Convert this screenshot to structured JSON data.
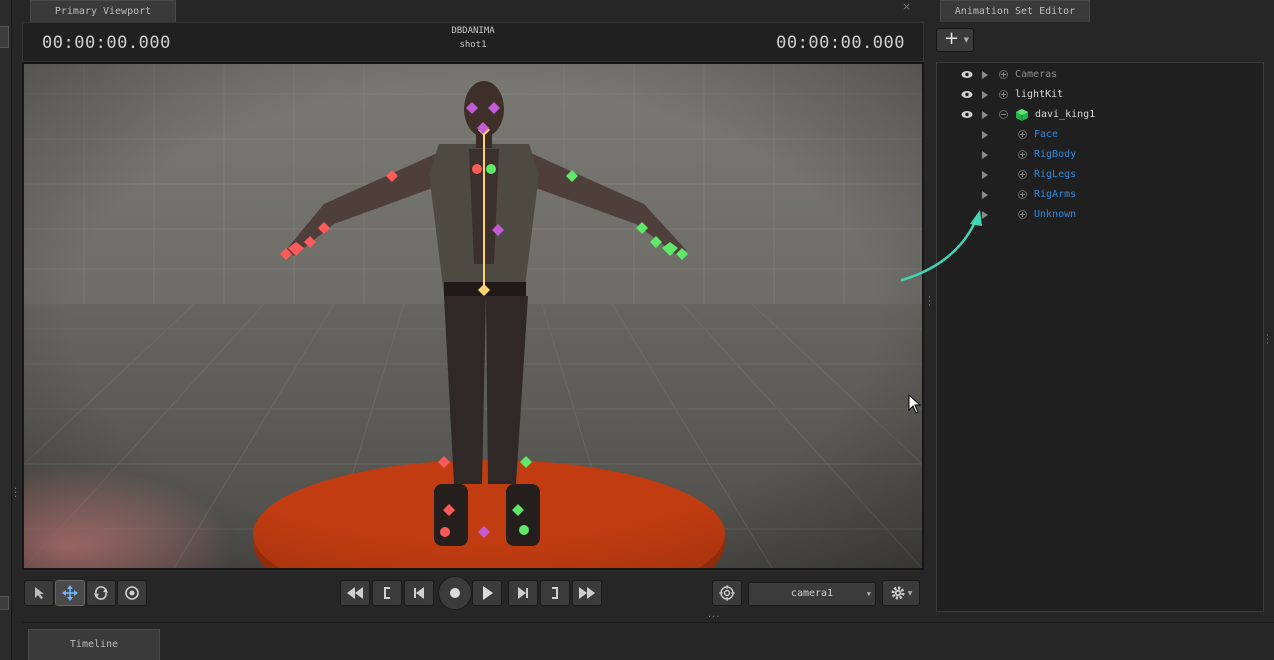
{
  "viewport": {
    "tab_label": "Primary Viewport",
    "close_glyph": "×",
    "timecode_left": "00:00:00.000",
    "timecode_right": "00:00:00.000",
    "session_name": "DBDANIMA",
    "shot_name": "shot1",
    "tools": [
      {
        "name": "select-tool",
        "icon": "arrow-cursor-icon"
      },
      {
        "name": "move-tool",
        "icon": "move-arrows-icon",
        "active": true
      },
      {
        "name": "rotate-tool",
        "icon": "rotate-icon"
      },
      {
        "name": "scale-tool",
        "icon": "scale-target-icon"
      }
    ],
    "camera_select": "camera1"
  },
  "animation_set_editor": {
    "tab_label": "Animation Set Editor",
    "add_button": "+",
    "rows": [
      {
        "label": "Cameras",
        "visible_eye": true,
        "style": "grey"
      },
      {
        "label": "lightKit",
        "visible_eye": true,
        "style": "white"
      },
      {
        "label": "davi_king1",
        "visible_eye": true,
        "style": "white",
        "expanded": true,
        "icon": "green-cube-icon"
      },
      {
        "label": "Face",
        "style": "blue"
      },
      {
        "label": "RigBody",
        "style": "blue"
      },
      {
        "label": "RigLegs",
        "style": "blue"
      },
      {
        "label": "RigArms",
        "style": "blue"
      },
      {
        "label": "Unknown",
        "style": "blue"
      }
    ]
  },
  "timeline": {
    "tab_label": "Timeline"
  },
  "colors": {
    "accent_blue": "#2e8bdd",
    "annotation_arrow": "#3fd6b4",
    "left_controls": "#ff5a5a",
    "right_controls": "#5fe86a",
    "center_controls": "#c35ad6",
    "spine_controls": "#ffd26a"
  }
}
